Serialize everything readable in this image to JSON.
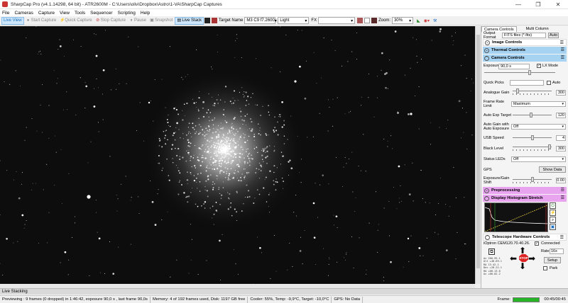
{
  "window": {
    "title": "SharpCap Pro (v4.1.14298, 64 bit) - ATR2600M - C:\\Users\\oliv\\Dropbox\\Astro\\1-VA\\SharpCap Captures",
    "controls": [
      "minimize-icon",
      "restore-icon",
      "close-icon"
    ]
  },
  "menu": [
    "File",
    "Cameras",
    "Capture",
    "View",
    "Tools",
    "Sequencer",
    "Scripting",
    "Help"
  ],
  "toolbar": {
    "live_view": "Live View",
    "start_capture": "Start Capture",
    "quick_capture": "Quick Capture",
    "stop_capture": "Stop Capture",
    "pause": "Pause",
    "snapshot": "Snapshot",
    "live_stack": "Live Stack",
    "target_name_label": "Target Name",
    "target_name_value": "M3 C9 f7.2600",
    "frame_type": "Light",
    "fx_label": "FX",
    "zoom_label": "Zoom:",
    "zoom_value": "30%"
  },
  "panel": {
    "tabs": [
      "Camera Controls",
      "Multi Column"
    ],
    "output_format_label": "Output Format",
    "output_format_value": "FITS files (*.fits)",
    "auto_label": "Auto",
    "sections": {
      "image_controls": "Image Controls",
      "thermal_controls": "Thermal Controls",
      "camera_controls": "Camera Controls",
      "preprocessing": "Preprocessing",
      "histogram": "Display Histogram Stretch",
      "telescope": "Telescope Hardware Controls"
    },
    "exposure": {
      "label": "Exposure",
      "value": "90,0 s",
      "lx_mode": "LX Mode"
    },
    "quick_picks": {
      "label": "Quick Picks",
      "auto": "Auto"
    },
    "analogue_gain": {
      "label": "Analogue Gain",
      "value": "300",
      "level": 0.1
    },
    "frame_rate_limit": {
      "label": "Frame Rate Limit",
      "value": "Maximum"
    },
    "auto_exp_target": {
      "label": "Auto Exp Target",
      "value": "120",
      "level": 0.47
    },
    "auto_gain": {
      "label": "Auto Gain with Auto Exposure",
      "value": "Off"
    },
    "usb_speed": {
      "label": "USB Speed",
      "value": "4",
      "level": 0.5
    },
    "black_level": {
      "label": "Black Level",
      "value": "300",
      "level": 0.98
    },
    "status_leds": {
      "label": "Status LEDs",
      "value": "Off"
    },
    "gps": {
      "label": "GPS",
      "button": "Show Data"
    },
    "exposure_gain_shift": {
      "label": "Exposure/Gain Shift",
      "value": "0.00",
      "level": 0.5
    },
    "mount": {
      "name": "iOptron CEM120.70.40.26.",
      "connected": "Connected",
      "rate_label": "Rate:",
      "rate_value": "16x",
      "setup": "Setup",
      "park": "Park",
      "stop": "STOP",
      "coords": [
        "Az  200.95.1",
        "Alt +48.69.1",
        "RA   13.42.1",
        "Dec +28.22.1",
        "HA  +00.13.0",
        "Az  +00.02.2"
      ]
    },
    "colors": {
      "blue_header": "#a7d3f3",
      "pink_header": "#e8a4ef"
    }
  },
  "live_stacking_label": "Live Stacking",
  "status": {
    "preview": "Previewing : 9 frames (0 dropped) in 1:46:42, exposure 90,0 s , last frame 90,0s",
    "memory": "Memory: 4 of 192 frames used, Disk: 1197 GB free",
    "cooler": "Cooler: 55%, Temp: -9,9°C, Target: -10,0°C",
    "gps": "GPS: No Data",
    "frame_label": "Frame:",
    "frame_progress": 1.0,
    "time": "00:45/00:45"
  }
}
